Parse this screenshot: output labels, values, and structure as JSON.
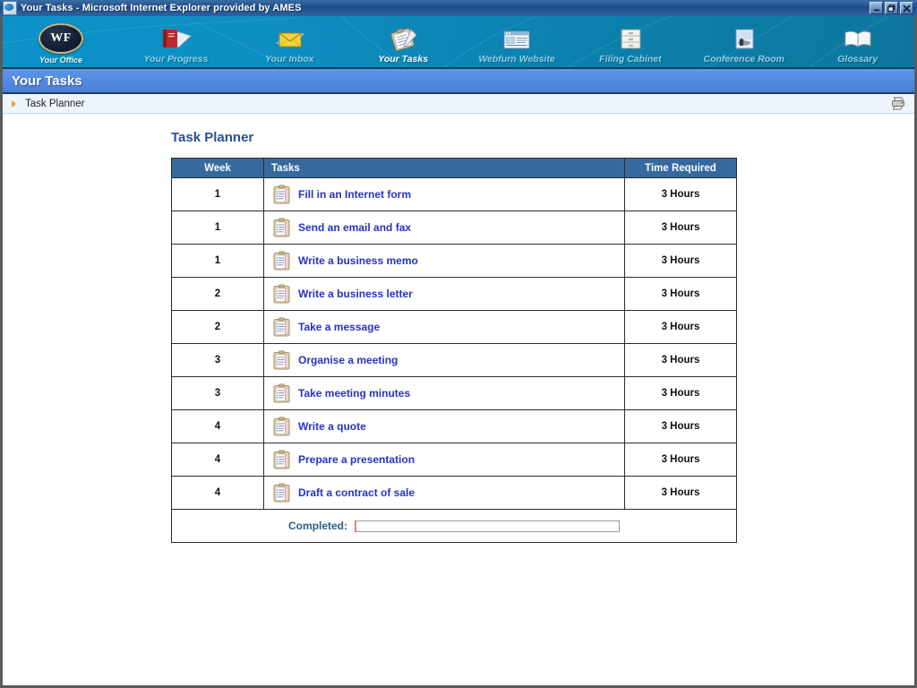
{
  "window": {
    "title": "Your Tasks - Microsoft Internet Explorer provided by AMES",
    "app_icon": "ie-document-icon",
    "buttons": {
      "minimize": "_",
      "restore": "❐",
      "close": "✕"
    }
  },
  "nav": {
    "logo": {
      "monogram": "WF",
      "caption": "Your Office",
      "icon": "wf-oval-logo"
    },
    "items": [
      {
        "label": "Your Progress",
        "icon": "red-book-icon",
        "active": false
      },
      {
        "label": "Your Inbox",
        "icon": "envelope-icon",
        "active": false
      },
      {
        "label": "Your Tasks",
        "icon": "clipboard-pen-icon",
        "active": true
      },
      {
        "label": "Webfurn Website",
        "icon": "browser-window-icon",
        "active": false
      },
      {
        "label": "Filing Cabinet",
        "icon": "filing-cabinet-icon",
        "active": false
      },
      {
        "label": "Conference Room",
        "icon": "conference-room-icon",
        "active": false
      },
      {
        "label": "Glossary",
        "icon": "open-book-icon",
        "active": false
      }
    ]
  },
  "section": {
    "title": "Your Tasks"
  },
  "breadcrumb": {
    "bullet": "orange-triangle-icon",
    "text": "Task Planner",
    "print_icon": "printer-icon"
  },
  "main": {
    "page_title": "Task Planner",
    "table": {
      "columns": {
        "week": "Week",
        "tasks": "Tasks",
        "time": "Time Required"
      },
      "row_icon": "clipboard-checklist-icon",
      "rows": [
        {
          "week": "1",
          "task": "Fill in an Internet form",
          "time": "3 Hours"
        },
        {
          "week": "1",
          "task": "Send an email and fax",
          "time": "3 Hours"
        },
        {
          "week": "1",
          "task": "Write a business memo",
          "time": "3 Hours"
        },
        {
          "week": "2",
          "task": "Write a business letter",
          "time": "3 Hours"
        },
        {
          "week": "2",
          "task": "Take a message",
          "time": "3 Hours"
        },
        {
          "week": "3",
          "task": "Organise a meeting",
          "time": "3 Hours"
        },
        {
          "week": "3",
          "task": "Take meeting minutes",
          "time": "3 Hours"
        },
        {
          "week": "4",
          "task": "Write a quote",
          "time": "3 Hours"
        },
        {
          "week": "4",
          "task": "Prepare a presentation",
          "time": "3 Hours"
        },
        {
          "week": "4",
          "task": "Draft a contract of sale",
          "time": "3 Hours"
        }
      ],
      "footer": {
        "label": "Completed:",
        "progress_percent": 0
      }
    }
  },
  "colors": {
    "titlebar": "#1E4C8A",
    "nav_left": "#0C93C9",
    "nav_right": "#0D769D",
    "section_header": "#5389E0",
    "table_header": "#36699E",
    "link": "#2633C4",
    "page_title": "#2A4F97",
    "breadcrumb_bg": "#EEF6FC",
    "bullet": "#F0A01E"
  }
}
